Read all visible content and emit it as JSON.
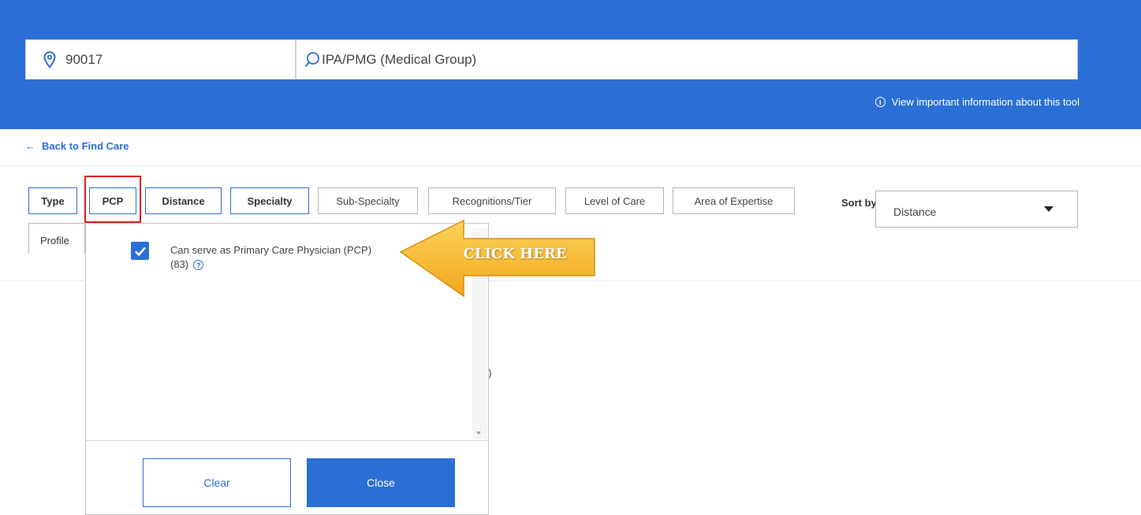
{
  "header": {
    "location_value": "90017",
    "search_value": "IPA/PMG (Medical Group)",
    "info_link": "View important information about this tool",
    "info_icon_glyph": "i"
  },
  "nav": {
    "back_label": "Back to Find Care",
    "back_arrow": "←"
  },
  "filters": {
    "chips": [
      "Type",
      "PCP",
      "Distance",
      "Specialty",
      "Sub-Specialty",
      "Recognitions/Tier",
      "Level of Care",
      "Area of Expertise"
    ],
    "active": [
      "Type",
      "PCP",
      "Distance",
      "Specialty"
    ]
  },
  "sort": {
    "label": "Sort by:",
    "value": "Distance"
  },
  "tabs": {
    "profile": "Profile"
  },
  "background_fragment": "o)",
  "pcp_dropdown": {
    "option_label_line1": "Can serve as Primary Care Physician (PCP)",
    "option_count": "(83)",
    "option_checked": true,
    "help_glyph": "?",
    "clear_label": "Clear",
    "close_label": "Close"
  },
  "annotation": {
    "callout_text": "CLICK HERE",
    "callout_color": "#f7b928",
    "highlight_color": "#e02020"
  },
  "colors": {
    "brand_blue": "#2b6fd6"
  },
  "icons": [
    "location-pin-icon",
    "search-icon",
    "info-icon",
    "back-arrow-icon",
    "checkbox-check-icon",
    "help-icon",
    "caret-down-icon"
  ]
}
